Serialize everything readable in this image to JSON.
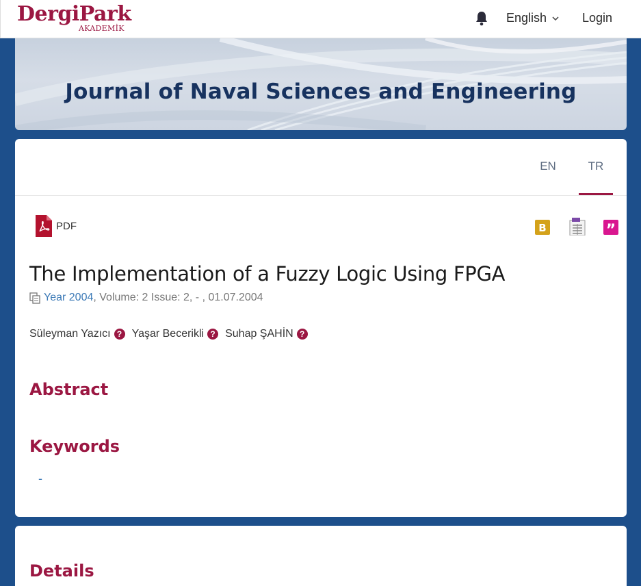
{
  "header": {
    "logo_main": "DergiPark",
    "logo_sub": "AKADEMİK",
    "language": "English",
    "login": "Login"
  },
  "banner": {
    "title": "Journal of Naval Sciences and Engineering"
  },
  "tabs": [
    {
      "label": "EN"
    },
    {
      "label": "TR"
    }
  ],
  "toolbar": {
    "pdf_label": "PDF"
  },
  "article": {
    "title": "The Implementation of a Fuzzy Logic Using FPGA",
    "year_link": "Year 2004",
    "meta_rest": ", Volume: 2 Issue: 2, - , 01.07.2004",
    "authors": [
      "Süleyman Yazıcı",
      "Yaşar Becerikli",
      "Suhap ŞAHİN"
    ]
  },
  "sections": {
    "abstract": "Abstract",
    "keywords": "Keywords",
    "keywords_value": "-",
    "details": "Details"
  },
  "colors": {
    "brand": "#9b1742",
    "link": "#3b79b6",
    "navy": "#1d4f8b"
  }
}
